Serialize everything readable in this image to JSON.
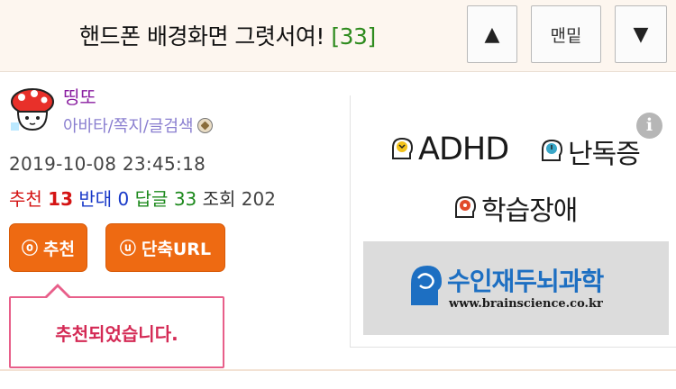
{
  "header": {
    "title": "핸드폰 배경화면 그렷서여!",
    "comment_count": "[33]",
    "nav_up_icon": "triangle-up-icon",
    "nav_up_label": "▲",
    "nav_bottom_label": "맨밑",
    "nav_down_icon": "triangle-down-icon",
    "nav_down_label": "▼"
  },
  "author": {
    "avatar_icon": "mushroom-avatar-icon",
    "nickname": "띵또",
    "links": "아바타/쪽지/글검색",
    "level_icon": "level-badge-icon"
  },
  "post": {
    "datetime": "2019-10-08 23:45:18",
    "recommend_label": "추천",
    "recommend_count": "13",
    "oppose_label": "반대",
    "oppose_count": "0",
    "reply_label": "답글",
    "reply_count": "33",
    "view_label": "조회",
    "view_count": "202"
  },
  "actions": {
    "recommend_icon": "ⓞ",
    "recommend_button": "추천",
    "shorturl_icon": "ⓤ",
    "shorturl_button": "단축URL"
  },
  "tooltip": {
    "message": "추천되었습니다."
  },
  "ad": {
    "info_icon": "i",
    "item1": "ADHD",
    "item2": "난독증",
    "item3": "학습장애",
    "brand_name": "수인재두뇌과학",
    "brand_url": "www.brainscience.co.kr"
  },
  "colors": {
    "accent_orange": "#ee6a12",
    "count_green": "#2e8b1e",
    "nickname_purple": "#8a1ea0",
    "link_lavender": "#8a7fd0",
    "tooltip_pink": "#e85f8a",
    "brand_blue": "#1d6fc2"
  }
}
